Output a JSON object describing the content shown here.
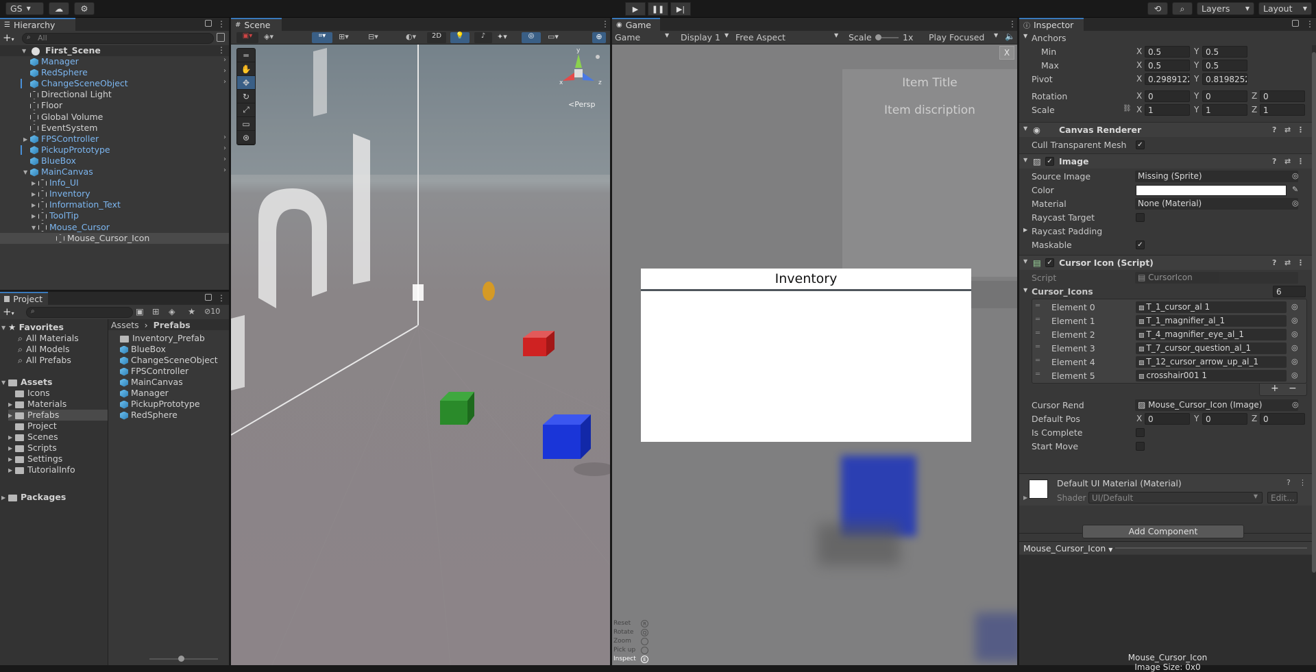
{
  "topbar": {
    "account": "GS",
    "layers": "Layers",
    "layout": "Layout"
  },
  "hierarchy": {
    "tab": "Hierarchy",
    "search_placeholder": "All",
    "scene": "First_Scene",
    "items": [
      {
        "label": "Manager",
        "type": "prefab"
      },
      {
        "label": "RedSphere",
        "type": "prefab"
      },
      {
        "label": "ChangeSceneObject",
        "type": "prefab"
      },
      {
        "label": "Directional Light",
        "type": "object"
      },
      {
        "label": "Floor",
        "type": "object"
      },
      {
        "label": "Global Volume",
        "type": "object"
      },
      {
        "label": "EventSystem",
        "type": "object"
      },
      {
        "label": "FPSController",
        "type": "prefab"
      },
      {
        "label": "PickupPrototype",
        "type": "prefab"
      },
      {
        "label": "BlueBox",
        "type": "prefab"
      },
      {
        "label": "MainCanvas",
        "type": "prefab"
      },
      {
        "label": "Info_UI",
        "type": "child"
      },
      {
        "label": "Inventory",
        "type": "child"
      },
      {
        "label": "Information_Text",
        "type": "child"
      },
      {
        "label": "ToolTip",
        "type": "child"
      },
      {
        "label": "Mouse_Cursor",
        "type": "child"
      },
      {
        "label": "Mouse_Cursor_Icon",
        "type": "grandchild"
      }
    ]
  },
  "project": {
    "tab": "Project",
    "hidden_count": "10",
    "favorites": "Favorites",
    "fav_items": [
      "All Materials",
      "All Models",
      "All Prefabs"
    ],
    "assets": "Assets",
    "asset_folders": [
      "Icons",
      "Materials",
      "Prefabs",
      "Project",
      "Scenes",
      "Scripts",
      "Settings",
      "TutorialInfo"
    ],
    "packages": "Packages",
    "breadcrumb_root": "Assets",
    "breadcrumb_current": "Prefabs",
    "files": [
      "Inventory_Prefab",
      "BlueBox",
      "ChangeSceneObject",
      "FPSController",
      "MainCanvas",
      "Manager",
      "PickupPrototype",
      "RedSphere"
    ]
  },
  "scene": {
    "tab": "Scene",
    "mode_2d": "2D",
    "persp": "Persp",
    "gizmo_x": "x",
    "gizmo_z": "z",
    "gizmo_y": "y"
  },
  "game": {
    "tab": "Game",
    "view": "Game",
    "display": "Display 1",
    "aspect": "Free Aspect",
    "scale_label": "Scale",
    "scale_value": "1x",
    "play_focused": "Play Focused",
    "close": "X",
    "item_title": "Item Title",
    "item_description": "Item discription",
    "inventory_title": "Inventory",
    "controls": [
      "Reset",
      "Rotate",
      "Zoom",
      "Pick up",
      "Inspect"
    ],
    "control_keys": [
      "R",
      "Q",
      "",
      "",
      "E"
    ]
  },
  "inspector": {
    "tab": "Inspector",
    "anchors": "Anchors",
    "min": "Min",
    "max": "Max",
    "pivot": "Pivot",
    "rotation": "Rotation",
    "scale": "Scale",
    "anchor_min_x": "0.5",
    "anchor_min_y": "0.5",
    "anchor_max_x": "0.5",
    "anchor_max_y": "0.5",
    "pivot_x": "0.2989122",
    "pivot_y": "0.8198252",
    "rot_x": "0",
    "rot_y": "0",
    "rot_z": "0",
    "scale_x": "1",
    "scale_y": "1",
    "scale_z": "1",
    "canvas_renderer": "Canvas Renderer",
    "cull_transparent": "Cull Transparent Mesh",
    "image": "Image",
    "source_image": "Source Image",
    "source_image_val": "Missing (Sprite)",
    "color": "Color",
    "color_value": "#ffffff",
    "material": "Material",
    "material_val": "None (Material)",
    "raycast_target": "Raycast Target",
    "raycast_padding": "Raycast Padding",
    "maskable": "Maskable",
    "cursor_script": "Cursor Icon (Script)",
    "script": "Script",
    "script_val": "CursorIcon",
    "cursor_icons": "Cursor_Icons",
    "cursor_icons_count": "6",
    "elements": [
      {
        "label": "Element 0",
        "value": "T_1_cursor_al 1"
      },
      {
        "label": "Element 1",
        "value": "T_1_magnifier_al_1"
      },
      {
        "label": "Element 2",
        "value": "T_4_magnifier_eye_al_1"
      },
      {
        "label": "Element 3",
        "value": "T_7_cursor_question_al_1"
      },
      {
        "label": "Element 4",
        "value": "T_12_cursor_arrow_up_al_1"
      },
      {
        "label": "Element 5",
        "value": "crosshair001 1"
      }
    ],
    "cursor_rend": "Cursor Rend",
    "cursor_rend_val": "Mouse_Cursor_Icon (Image)",
    "default_pos": "Default Pos",
    "dp_x": "0",
    "dp_y": "0",
    "dp_z": "0",
    "is_complete": "Is Complete",
    "start_move": "Start Move",
    "default_material": "Default UI Material (Material)",
    "shader": "Shader",
    "shader_val": "UI/Default",
    "edit": "Edit...",
    "add_component": "Add Component",
    "preview_name": "Mouse_Cursor_Icon",
    "preview_footer": "Mouse_Cursor_Icon",
    "image_size": "Image Size: 0x0"
  }
}
